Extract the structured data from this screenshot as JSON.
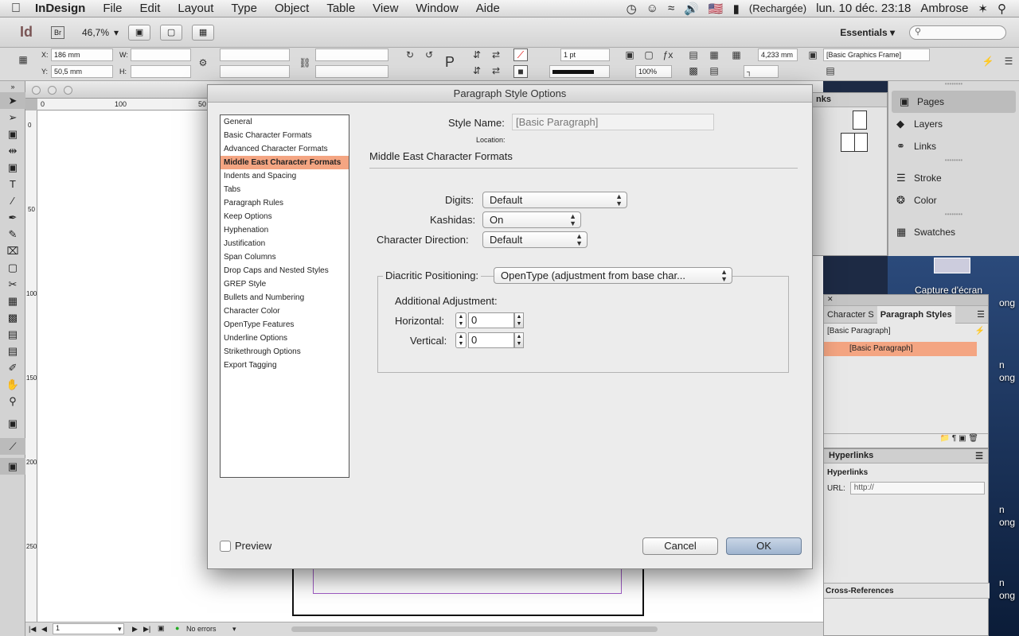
{
  "menubar": {
    "apple": "",
    "items": [
      "InDesign",
      "File",
      "Edit",
      "Layout",
      "Type",
      "Object",
      "Table",
      "View",
      "Window",
      "Aide"
    ],
    "battery": "(Rechargée)",
    "clock": "lun. 10 déc.  23:18",
    "user": "Ambrose",
    "flag": "🇺🇸",
    "search_icon": "search-icon"
  },
  "appbar": {
    "logo": "Id",
    "bridge": "Br",
    "zoom": "46,7%",
    "workspace": "Essentials",
    "workspace_arrow": "▾",
    "search_value": ""
  },
  "controlbar": {
    "x_label": "X:",
    "x_value": "186 mm",
    "y_label": "Y:",
    "y_value": "50,5 mm",
    "w_label": "W:",
    "h_label": "H:",
    "stroke_weight": "1 pt",
    "opacity": "100%",
    "gap": "4,233 mm",
    "object_style": "[Basic Graphics Frame]"
  },
  "ruler": {
    "h_ticks": [
      "0",
      "100",
      "50"
    ],
    "v_ticks": [
      "0",
      "50",
      "100",
      "150",
      "200",
      "250"
    ]
  },
  "status": {
    "page": "1",
    "errors": "No errors"
  },
  "dock": {
    "items": [
      {
        "label": "Pages",
        "icon": "pages-icon"
      },
      {
        "label": "Layers",
        "icon": "layers-icon"
      },
      {
        "label": "Links",
        "icon": "links-icon"
      },
      {
        "label": "Stroke",
        "icon": "stroke-icon"
      },
      {
        "label": "Color",
        "icon": "color-icon"
      },
      {
        "label": "Swatches",
        "icon": "swatches-icon"
      }
    ],
    "pages_tab": "nks"
  },
  "desktop": {
    "capture_label": "Capture d'écran",
    "fragment1": "ong",
    "fragment2": "n",
    "fragment3": "ong",
    "fragment4": "n",
    "fragment5": "ong",
    "fragment6": "n",
    "fragment7": "ong"
  },
  "styles_panel": {
    "tab_character": "Character S",
    "tab_paragraph": "Paragraph Styles",
    "current": "[Basic Paragraph]",
    "selected_item": "[Basic Paragraph]"
  },
  "hyperlinks_panel": {
    "tab": "Hyperlinks",
    "title": "Hyperlinks",
    "url_label": "URL:",
    "url_value": "http://",
    "xref": "Cross-References"
  },
  "dialog": {
    "title": "Paragraph Style Options",
    "categories": [
      "General",
      "Basic Character Formats",
      "Advanced Character Formats",
      "Middle East Character Formats",
      "Indents and Spacing",
      "Tabs",
      "Paragraph Rules",
      "Keep Options",
      "Hyphenation",
      "Justification",
      "Span Columns",
      "Drop Caps and Nested Styles",
      "GREP Style",
      "Bullets and Numbering",
      "Character Color",
      "OpenType Features",
      "Underline Options",
      "Strikethrough Options",
      "Export Tagging"
    ],
    "selected_category_index": 3,
    "style_name_label": "Style Name:",
    "style_name_value": "[Basic Paragraph]",
    "location_label": "Location:",
    "section_title": "Middle East Character Formats",
    "digits_label": "Digits:",
    "digits_value": "Default",
    "kashidas_label": "Kashidas:",
    "kashidas_value": "On",
    "char_direction_label": "Character Direction:",
    "char_direction_value": "Default",
    "diacritic_label": "Diacritic Positioning:",
    "diacritic_value": "OpenType (adjustment from base char...",
    "additional_label": "Additional Adjustment:",
    "horizontal_label": "Horizontal:",
    "horizontal_value": "0",
    "vertical_label": "Vertical:",
    "vertical_value": "0",
    "preview_label": "Preview",
    "preview_checked": false,
    "cancel_label": "Cancel",
    "ok_label": "OK"
  },
  "colors": {
    "selection": "#f4a582",
    "margin_guide": "#a15cc7",
    "default_button": "#9fb4cf"
  }
}
